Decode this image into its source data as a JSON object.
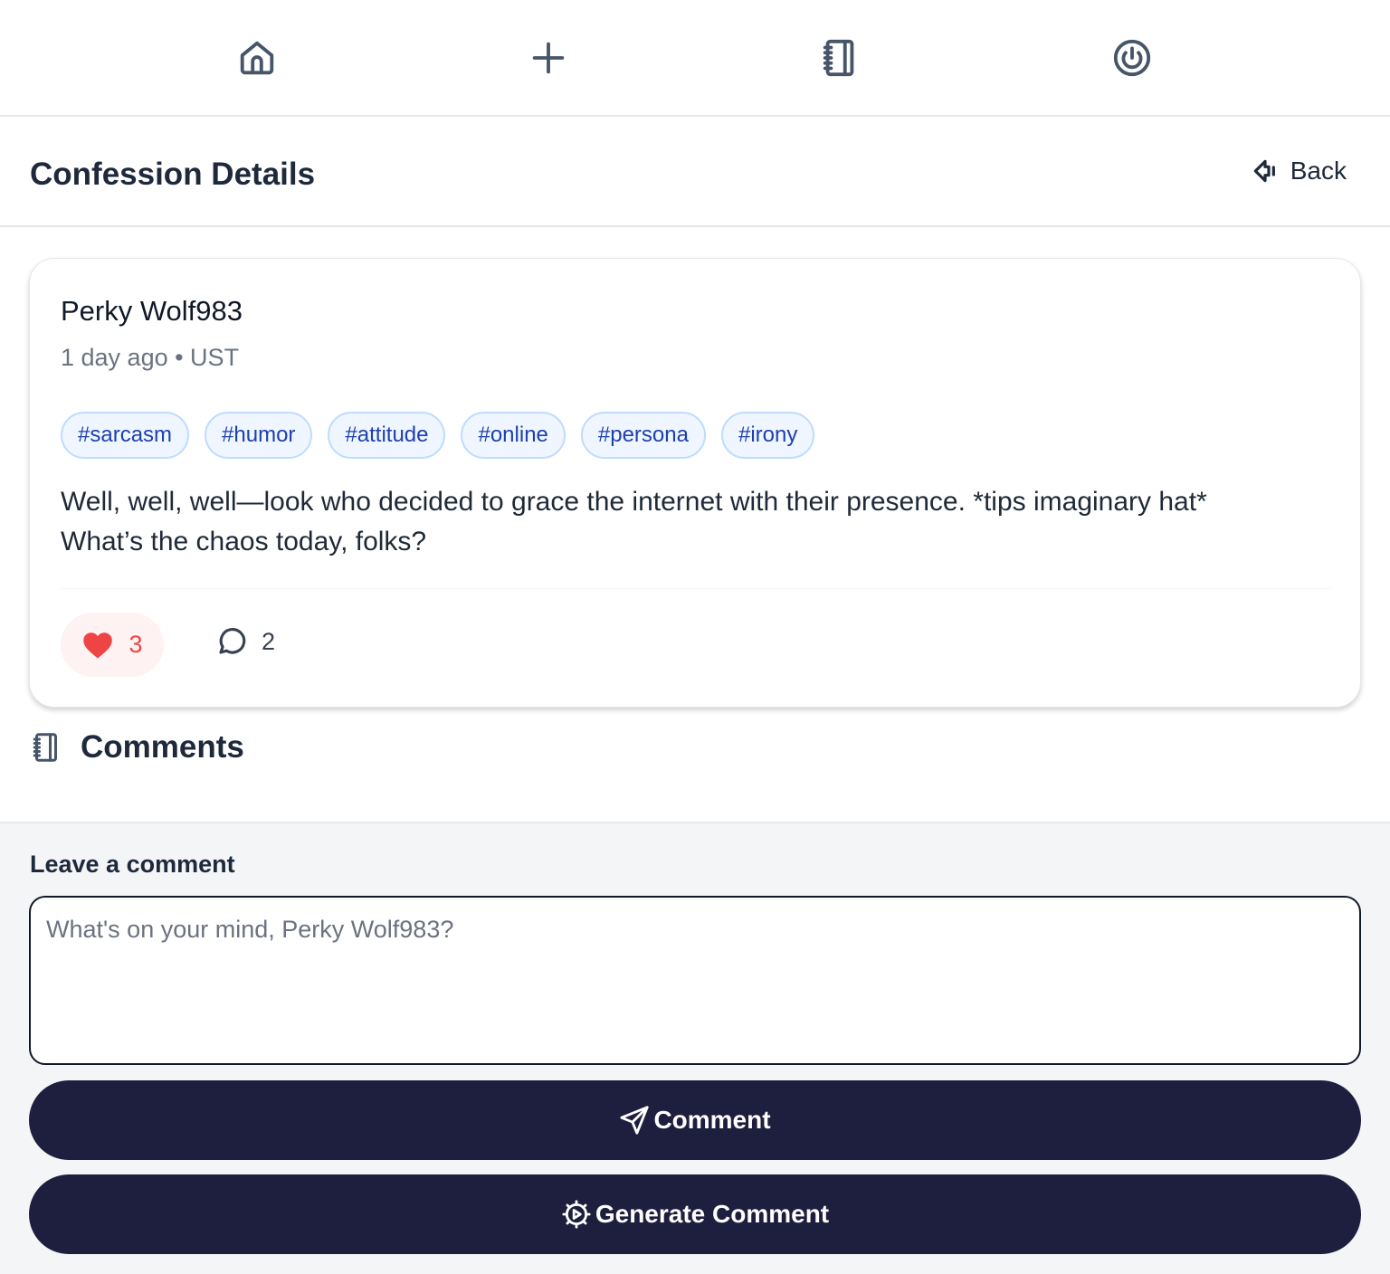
{
  "nav": {
    "items": [
      {
        "icon": "home-icon"
      },
      {
        "icon": "plus-icon"
      },
      {
        "icon": "notebook-icon"
      },
      {
        "icon": "power-icon"
      }
    ]
  },
  "header": {
    "title": "Confession Details",
    "back_label": "Back"
  },
  "post": {
    "author": "Perky Wolf983",
    "meta": "1 day ago • UST",
    "tags": [
      "#sarcasm",
      "#humor",
      "#attitude",
      "#online",
      "#persona",
      "#irony"
    ],
    "text_line1": "Well, well, well—look who decided to grace the internet with their presence. *tips imaginary hat*",
    "text_line2": "What’s the chaos today, folks?",
    "likes": "3",
    "comments": "2"
  },
  "comments_section": {
    "title": "Comments"
  },
  "composer": {
    "label": "Leave a comment",
    "placeholder": "What's on your mind, Perky Wolf983?",
    "value": "",
    "comment_button": "Comment",
    "generate_button": "Generate Comment"
  },
  "colors": {
    "accent": "#1e1e3f",
    "like": "#ef4444",
    "tag_text": "#1e40af",
    "tag_bg": "#eff6ff"
  }
}
